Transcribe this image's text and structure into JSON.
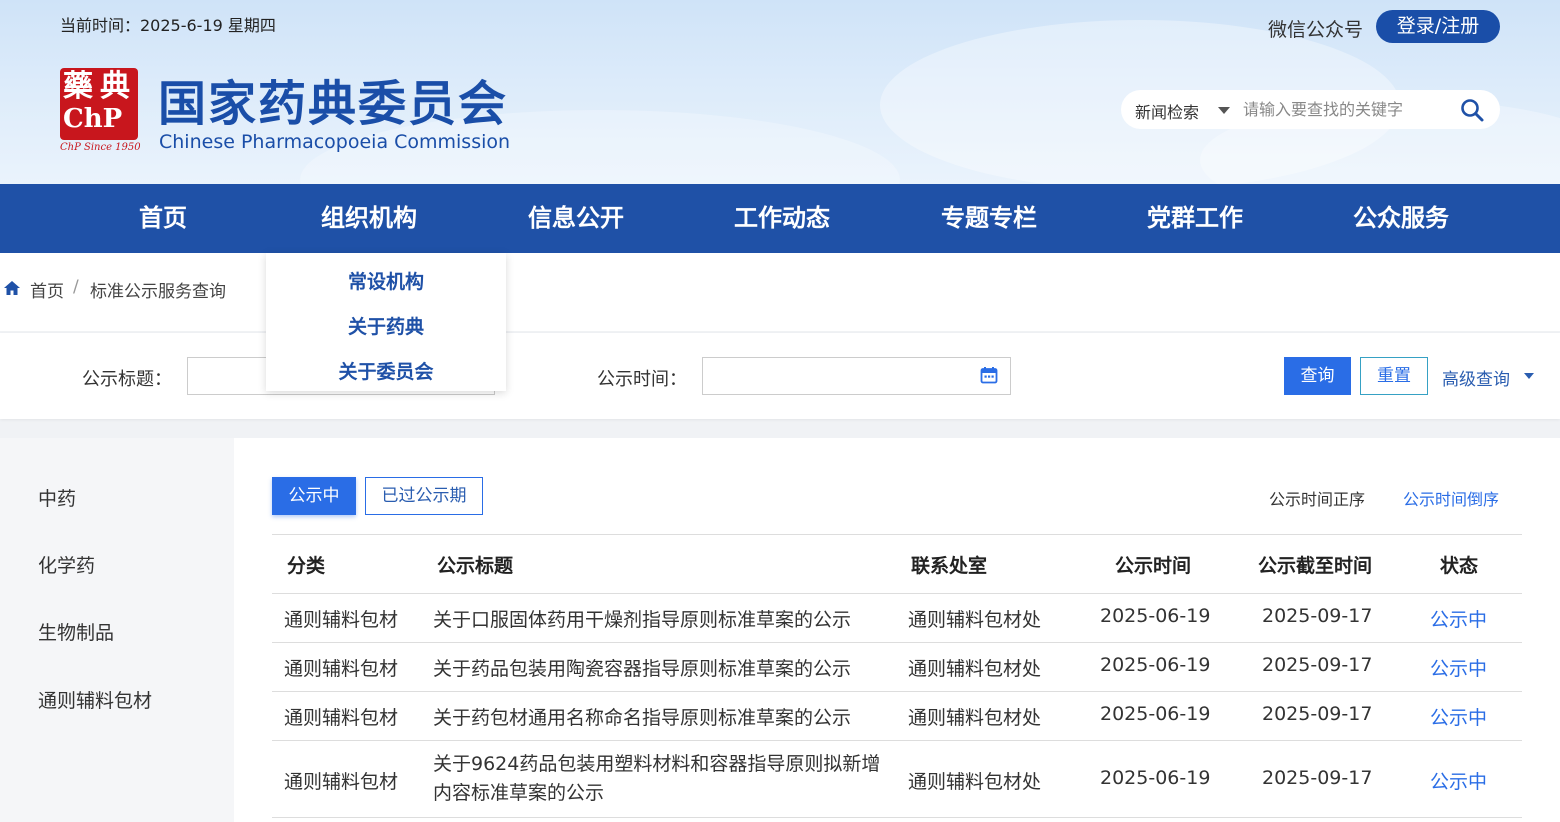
{
  "header": {
    "date": "当前时间：2025-6-19 星期四",
    "wechat": "微信公众号",
    "login": "登录/注册",
    "logo_cn": "国家药典委员会",
    "logo_en": "Chinese Pharmacopoeia Commission",
    "seal_caption": "ChP Since 1950",
    "search": {
      "type": "新闻检索",
      "placeholder": "请输入要查找的关键字",
      "icon": "search-icon"
    }
  },
  "nav": {
    "items": [
      "首页",
      "组织机构",
      "信息公开",
      "工作动态",
      "专题专栏",
      "党群工作",
      "公众服务"
    ]
  },
  "dropdown": {
    "items": [
      "常设机构",
      "关于药典",
      "关于委员会"
    ]
  },
  "breadcrumb": {
    "home": "首页",
    "separator": "/",
    "current": "标准公示服务查询"
  },
  "filter": {
    "title_label": "公示标题：",
    "title_value": "",
    "time_label": "公示时间：",
    "time_value": "",
    "query": "查询",
    "reset": "重置",
    "advanced": "高级查询"
  },
  "sidebar": {
    "items": [
      "中药",
      "化学药",
      "生物制品",
      "通则辅料包材"
    ]
  },
  "tabs": {
    "active": "公示中",
    "past": "已过公示期",
    "sort_asc": "公示时间正序",
    "sort_desc": "公示时间倒序"
  },
  "table": {
    "headers": [
      "分类",
      "公示标题",
      "联系处室",
      "公示时间",
      "公示截至时间",
      "状态"
    ],
    "rows": [
      {
        "category": "通则辅料包材",
        "title": "关于口服固体药用干燥剂指导原则标准草案的公示",
        "dept": "通则辅料包材处",
        "date": "2025-06-19",
        "end": "2025-09-17",
        "status": "公示中"
      },
      {
        "category": "通则辅料包材",
        "title": "关于药品包装用陶瓷容器指导原则标准草案的公示",
        "dept": "通则辅料包材处",
        "date": "2025-06-19",
        "end": "2025-09-17",
        "status": "公示中"
      },
      {
        "category": "通则辅料包材",
        "title": "关于药包材通用名称命名指导原则标准草案的公示",
        "dept": "通则辅料包材处",
        "date": "2025-06-19",
        "end": "2025-09-17",
        "status": "公示中"
      },
      {
        "category": "通则辅料包材",
        "title_line1": "关于9624药品包装用塑料材料和容器指导原则拟新增",
        "title_line2": "内容标准草案的公示",
        "dept": "通则辅料包材处",
        "date": "2025-06-19",
        "end": "2025-09-17",
        "status": "公示中"
      }
    ]
  },
  "colors": {
    "brand": "#1f51a7",
    "accent": "#2a6de6",
    "seal": "#c8161d"
  }
}
